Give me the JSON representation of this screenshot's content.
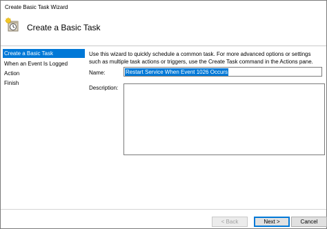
{
  "window": {
    "title": "Create Basic Task Wizard"
  },
  "header": {
    "title": "Create a Basic Task",
    "icon": "task-scheduler-clock-icon"
  },
  "nav": {
    "items": [
      {
        "label": "Create a Basic Task",
        "active": true
      },
      {
        "label": "When an Event Is Logged",
        "active": false
      },
      {
        "label": "Action",
        "active": false
      },
      {
        "label": "Finish",
        "active": false
      }
    ]
  },
  "main": {
    "intro_line1": "Use this wizard to quickly schedule a common task.  For more advanced options or settings",
    "intro_line2": "such as multiple task actions or triggers, use the Create Task command in the Actions pane.",
    "name_label": "Name:",
    "name_value": "Restart Service When Event 1026 Occurs",
    "description_label": "Description:",
    "description_value": ""
  },
  "buttons": {
    "back": "< Back",
    "next": "Next >",
    "cancel": "Cancel"
  },
  "colors": {
    "accent": "#0078d7"
  }
}
